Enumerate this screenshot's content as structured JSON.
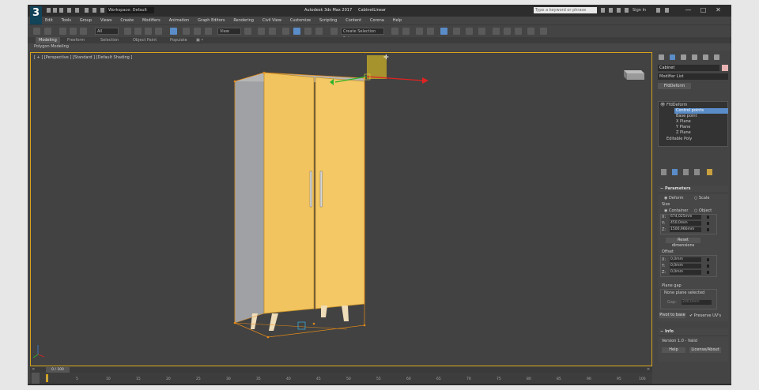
{
  "app": {
    "logo_text": "3",
    "workspace_label": "Workspace: Default",
    "title_app": "Autodesk 3ds Max 2017",
    "title_file": "CabinetLinear",
    "search_placeholder": "Type a keyword or phrase",
    "sign_in": "Sign In",
    "window_controls": [
      "—",
      "□",
      "✕"
    ]
  },
  "menu": [
    "Edit",
    "Tools",
    "Group",
    "Views",
    "Create",
    "Modifiers",
    "Animation",
    "Graph Editors",
    "Rendering",
    "Civil View",
    "Customize",
    "Scripting",
    "Content",
    "Corona",
    "Help"
  ],
  "toolbar": {
    "filter_value": "All",
    "view_value": "View",
    "selection_set_placeholder": "Create Selection Set"
  },
  "ribbon": {
    "tabs": [
      "Modeling",
      "Freeform",
      "Selection",
      "Object Paint",
      "Populate"
    ],
    "active": "Modeling",
    "subtab": "Polygon Modeling"
  },
  "viewport": {
    "label": "[ + ] [Perspective ] [Standard ] [Default Shading ]",
    "accent_color": "#d4a21a",
    "cabinet_color": "#f2c45f",
    "selection_color": "#e48a16"
  },
  "command_panel": {
    "object_name": "Cabinet",
    "modifier_list": "Modifier List",
    "ffd_button": "FfdDeform",
    "stack": {
      "items": [
        {
          "label": "FfdDeform",
          "level": 0
        },
        {
          "label": "Control points",
          "level": 1,
          "selected": true
        },
        {
          "label": "Base point",
          "level": 1
        },
        {
          "label": "X Plane",
          "level": 1
        },
        {
          "label": "Y Plane",
          "level": 1
        },
        {
          "label": "Z Plane",
          "level": 1
        },
        {
          "label": "Editable Poly",
          "level": 0
        }
      ]
    },
    "parameters": {
      "title": "Parameters",
      "mode_deform": "Deform",
      "mode_scale": "Scale",
      "size_label": "Size",
      "size_container": "Container",
      "size_object": "Object",
      "x_label": "X:",
      "x_value": "674,025mm",
      "y_label": "Y:",
      "y_value": "450,0mm",
      "z_label": "Z:",
      "z_value": "1500,966mm",
      "reset_dimensions": "Reset dimensions",
      "offset_label": "Offset",
      "offx_label": "X:",
      "offx_value": "0,0mm",
      "offy_label": "Y:",
      "offy_value": "0,0mm",
      "offz_label": "Z:",
      "offz_value": "0,0mm",
      "plane_gap_label": "Plane gap",
      "plane_none": "None plane selected",
      "gap_label": "Gap:",
      "gap_value": "200,0mm",
      "pivot_to_base": "Pivot to base",
      "preserve_uvs": "Preserve UV's"
    },
    "info": {
      "title": "Info",
      "version": "Version 1.0 - Valid",
      "help": "Help",
      "license": "License/About"
    }
  },
  "timeline": {
    "frame_label": "0 / 100",
    "ticks": [
      "0",
      "5",
      "10",
      "15",
      "20",
      "25",
      "30",
      "35",
      "40",
      "45",
      "50",
      "55",
      "60",
      "65",
      "70",
      "75",
      "80",
      "85",
      "90",
      "95",
      "100"
    ]
  }
}
